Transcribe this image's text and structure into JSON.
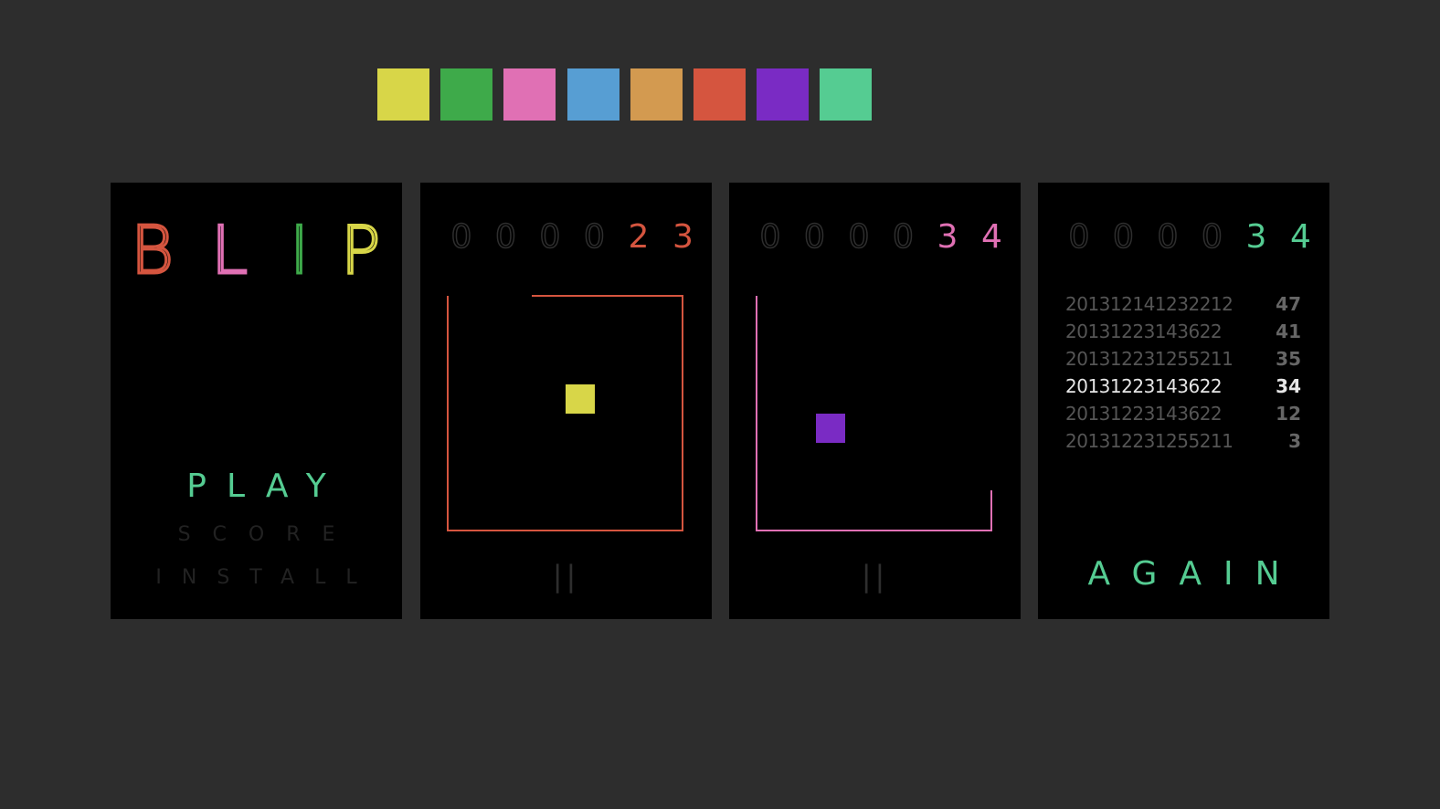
{
  "palette": {
    "colors": [
      "#d8d648",
      "#3eaa4a",
      "#e070b4",
      "#579ed3",
      "#d39a50",
      "#d5553f",
      "#7a2bc4",
      "#55cc92"
    ]
  },
  "menu_screen": {
    "title_letters": [
      {
        "char": "B",
        "color": "#d5553f"
      },
      {
        "char": "L",
        "color": "#e070b4"
      },
      {
        "char": "I",
        "color": "#3eaa4a"
      },
      {
        "char": "P",
        "color": "#d8d648"
      }
    ],
    "play_label": "PLAY",
    "play_color": "#55cc92",
    "score_label": "SCORE",
    "score_color": "#222222",
    "install_label": "INSTALL",
    "install_color": "#222222"
  },
  "game_screen_1": {
    "score_digits": [
      "0",
      "0",
      "0",
      "0",
      "2",
      "3"
    ],
    "active_digits": 2,
    "accent_color": "#d5553f",
    "target_color": "#d8d648",
    "pause_label": "||"
  },
  "game_screen_2": {
    "score_digits": [
      "0",
      "0",
      "0",
      "0",
      "3",
      "4"
    ],
    "active_digits": 2,
    "accent_color": "#e070b4",
    "target_color": "#7a2bc4",
    "pause_label": "||"
  },
  "scores_screen": {
    "score_digits": [
      "0",
      "0",
      "0",
      "0",
      "3",
      "4"
    ],
    "active_digits": 2,
    "accent_color": "#55cc92",
    "high_scores": [
      {
        "date": "201312141232212",
        "score": "47",
        "current": false
      },
      {
        "date": "20131223143622",
        "score": "41",
        "current": false
      },
      {
        "date": "201312231255211",
        "score": "35",
        "current": false
      },
      {
        "date": "20131223143622",
        "score": "34",
        "current": true
      },
      {
        "date": "20131223143622",
        "score": "12",
        "current": false
      },
      {
        "date": "201312231255211",
        "score": "3",
        "current": false
      }
    ],
    "again_label": "AGAIN",
    "again_color": "#55cc92"
  },
  "dim_color": "#2a2a2a"
}
